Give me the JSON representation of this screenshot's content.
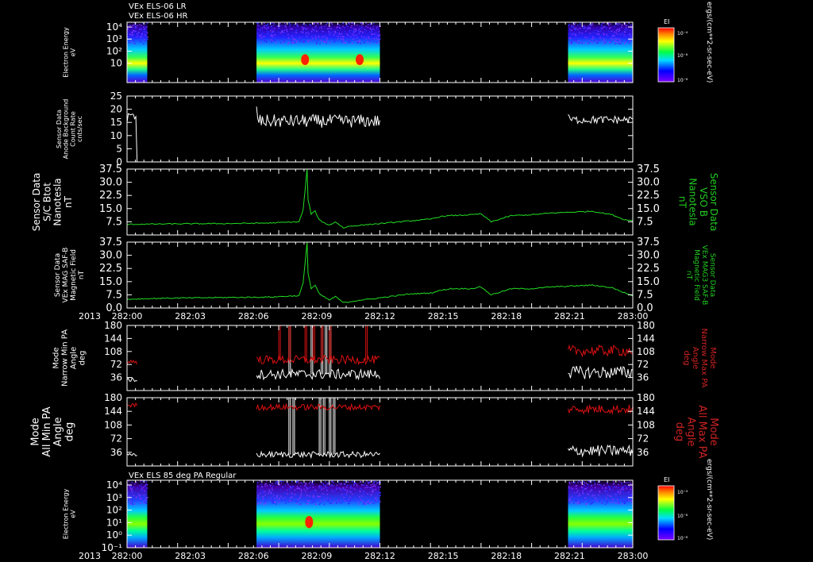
{
  "header": {
    "line1": "VEx ELS-06 LR",
    "line2": "VEx ELS-06 HR"
  },
  "year_label": "2013",
  "colorbar": {
    "title": "EI",
    "ticks": [
      "10⁻⁴",
      "10⁻⁸",
      "10⁻⁸"
    ],
    "units": "ergs/(cm**2-sr-sec-eV)"
  },
  "colors": {
    "background": "#000000",
    "frame": "#ffffff",
    "white_trace": "#ffffff",
    "green_trace": "#22dd22",
    "red_trace": "#dd1111",
    "green_label": "#22cc22",
    "red_label": "#cc2222"
  },
  "chart_data": [
    {
      "type": "heatmap",
      "panel": "spectrogram-top",
      "ylabel": [
        "Electron Energy",
        "eV"
      ],
      "yscale": "log",
      "yticks": [
        "10⁴",
        "10³",
        "10²",
        "10"
      ],
      "ylim": [
        1,
        20000
      ],
      "data_intervals": [
        [
          282.0,
          282.01
        ],
        [
          282.064,
          282.125
        ],
        [
          282.218,
          282.25
        ]
      ],
      "hot_spots": [
        {
          "t": 282.088,
          "level": "high"
        },
        {
          "t": 282.115,
          "level": "high"
        }
      ]
    },
    {
      "type": "line",
      "panel": "sensor-background",
      "ylabel": [
        "Sensor Data",
        "Anode Background",
        "Count Rate",
        "cnts/sec"
      ],
      "yticks": [
        "25",
        "20",
        "15",
        "10",
        "5",
        "0"
      ],
      "ylim": [
        0,
        25
      ],
      "series": [
        {
          "color": "white",
          "segments": [
            {
              "t0": 282.0,
              "t1": 282.005,
              "start": 15,
              "mean": 17,
              "noise": 2,
              "end": 0
            },
            {
              "t0": 282.064,
              "t1": 282.125,
              "start": 21,
              "mean": 15.5,
              "noise": 2.5
            },
            {
              "t0": 282.218,
              "t1": 282.25,
              "start": 18,
              "mean": 16,
              "noise": 1.5
            }
          ]
        }
      ]
    },
    {
      "type": "line",
      "panel": "btot",
      "ylabel": [
        "Sensor Data",
        "S/C Btot",
        "Nanotesla",
        "nT"
      ],
      "ylabel_right": [
        "Sensor Data",
        "VSO B",
        "Nanotesla",
        "nT"
      ],
      "yticks": [
        "37.5",
        "30.0",
        "22.5",
        "15.0",
        "7.5"
      ],
      "ylim": [
        0,
        37.5
      ],
      "series": [
        {
          "color": "green",
          "x": [
            282.0,
            282.02,
            282.05,
            282.07,
            282.085,
            282.087,
            282.088,
            282.089,
            282.0895,
            282.091,
            282.093,
            282.095,
            282.1,
            282.103,
            282.107,
            282.11,
            282.115,
            282.12,
            282.13,
            282.14,
            282.15,
            282.155,
            282.16,
            282.17,
            282.175,
            282.18,
            282.19,
            282.2,
            282.21,
            282.22,
            282.23,
            282.24,
            282.245,
            282.25
          ],
          "y": [
            6.0,
            6.3,
            6.5,
            6.8,
            7.5,
            14.0,
            25.0,
            37.5,
            20.0,
            12.0,
            13.5,
            8.5,
            5.5,
            7.5,
            4.0,
            5.0,
            5.5,
            6.0,
            7.0,
            8.0,
            9.0,
            10.5,
            11.0,
            11.5,
            12.0,
            7.5,
            11.0,
            11.5,
            12.5,
            13.0,
            13.5,
            11.5,
            9.0,
            8.0
          ]
        }
      ]
    },
    {
      "type": "line",
      "panel": "mag-saf-b",
      "ylabel": [
        "Sensor Data",
        "VEx MAG SAF-B",
        "Magnetic Field",
        "nT"
      ],
      "ylabel_right": [
        "Sensor Data",
        "VEx MAG3 SAF-B",
        "Magnetic Field",
        "nT"
      ],
      "yticks": [
        "37.5",
        "30.0",
        "22.5",
        "15.0",
        "7.5",
        "0.0"
      ],
      "ylim": [
        0,
        37.5
      ],
      "series": [
        {
          "color": "green",
          "x": [
            282.0,
            282.02,
            282.05,
            282.07,
            282.085,
            282.087,
            282.088,
            282.089,
            282.0895,
            282.091,
            282.093,
            282.095,
            282.1,
            282.103,
            282.107,
            282.11,
            282.115,
            282.12,
            282.13,
            282.14,
            282.15,
            282.155,
            282.16,
            282.17,
            282.175,
            282.18,
            282.19,
            282.2,
            282.21,
            282.22,
            282.23,
            282.24,
            282.245,
            282.25
          ],
          "y": [
            5.0,
            5.6,
            6.0,
            6.2,
            7.0,
            14.0,
            25.0,
            37.5,
            20.0,
            11.0,
            13.0,
            8.0,
            4.5,
            6.5,
            3.0,
            3.5,
            4.5,
            5.0,
            6.5,
            8.0,
            8.5,
            10.0,
            11.0,
            11.0,
            12.0,
            7.5,
            11.0,
            11.0,
            12.0,
            12.5,
            13.0,
            11.5,
            9.0,
            7.0
          ]
        }
      ]
    },
    {
      "type": "line",
      "panel": "narrow-pa",
      "ylabel": [
        "Mode",
        "Narrow Min PA",
        "Angle",
        "deg"
      ],
      "ylabel_right": [
        "Mode",
        "Narrow Max PA",
        "Angle",
        "deg"
      ],
      "yticks": [
        "180",
        "144",
        "108",
        "72",
        "36"
      ],
      "ylim": [
        0,
        180
      ],
      "series": [
        {
          "name": "Narrow Min PA",
          "color": "white",
          "segments": [
            {
              "t0": 282.0,
              "t1": 282.005,
              "mean": 30,
              "noise": 6
            },
            {
              "t0": 282.064,
              "t1": 282.125,
              "mean": 45,
              "noise": 14,
              "spikes": [
                282.08,
                282.091,
                282.096,
                282.098,
                282.1
              ]
            },
            {
              "t0": 282.218,
              "t1": 282.25,
              "mean": 50,
              "noise": 18
            }
          ]
        },
        {
          "name": "Narrow Max PA",
          "color": "red",
          "segments": [
            {
              "t0": 282.0,
              "t1": 282.005,
              "mean": 80,
              "noise": 8
            },
            {
              "t0": 282.064,
              "t1": 282.125,
              "mean": 85,
              "noise": 12,
              "spikes": [
                282.075,
                282.08,
                282.088,
                282.092,
                282.096,
                282.1,
                282.118
              ]
            },
            {
              "t0": 282.218,
              "t1": 282.25,
              "mean": 110,
              "noise": 15
            }
          ]
        }
      ]
    },
    {
      "type": "line",
      "panel": "all-pa",
      "ylabel": [
        "Mode",
        "All Min PA",
        "Angle",
        "deg"
      ],
      "ylabel_right": [
        "Mode",
        "All Max PA",
        "Angle",
        "deg"
      ],
      "yticks": [
        "180",
        "144",
        "108",
        "72",
        "36"
      ],
      "ylim": [
        0,
        180
      ],
      "series": [
        {
          "name": "All Min PA",
          "color": "white",
          "segments": [
            {
              "t0": 282.0,
              "t1": 282.005,
              "mean": 28,
              "noise": 5
            },
            {
              "t0": 282.064,
              "t1": 282.125,
              "mean": 30,
              "noise": 8,
              "spikes": [
                282.08,
                282.082,
                282.095,
                282.097,
                282.1,
                282.102
              ]
            },
            {
              "t0": 282.218,
              "t1": 282.25,
              "mean": 40,
              "noise": 15
            }
          ]
        },
        {
          "name": "All Max PA",
          "color": "red",
          "segments": [
            {
              "t0": 282.0,
              "t1": 282.005,
              "mean": 160,
              "noise": 6
            },
            {
              "t0": 282.064,
              "t1": 282.125,
              "mean": 155,
              "noise": 8
            },
            {
              "t0": 282.218,
              "t1": 282.25,
              "mean": 150,
              "noise": 12
            }
          ]
        }
      ]
    },
    {
      "type": "heatmap",
      "panel": "spectrogram-bottom",
      "title": "VEx ELS 85 deg PA Regular",
      "ylabel": [
        "Electron Energy",
        "eV"
      ],
      "yscale": "log",
      "yticks": [
        "10⁴",
        "10³",
        "10²",
        "10¹",
        "10⁰",
        "10⁻¹"
      ],
      "ylim": [
        0.1,
        20000
      ],
      "data_intervals": [
        [
          282.0,
          282.01
        ],
        [
          282.064,
          282.125
        ],
        [
          282.218,
          282.25
        ]
      ],
      "hot_spots": [
        {
          "t": 282.09,
          "level": "high"
        }
      ]
    }
  ],
  "time_axis": {
    "range": [
      282.0,
      282.25
    ],
    "ticks": [
      "282:00",
      "282:03",
      "282:06",
      "282:09",
      "282:12",
      "282:15",
      "282:18",
      "282:21",
      "283:00"
    ]
  }
}
